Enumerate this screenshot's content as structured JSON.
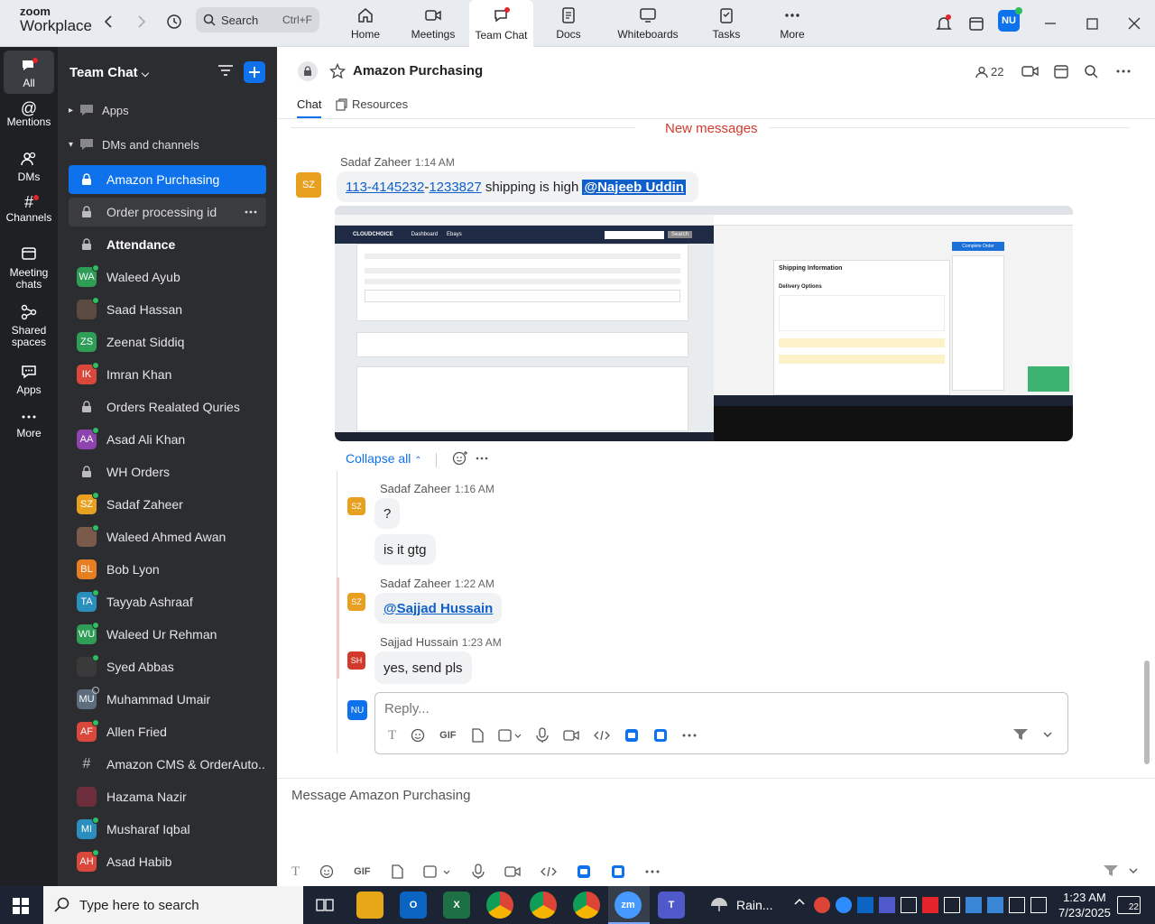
{
  "app": {
    "logo_top": "zoom",
    "logo_bottom": "Workplace"
  },
  "search": {
    "label": "Search",
    "shortcut": "Ctrl+F"
  },
  "tabs": [
    {
      "label": "Home"
    },
    {
      "label": "Meetings"
    },
    {
      "label": "Team Chat"
    },
    {
      "label": "Docs"
    },
    {
      "label": "Whiteboards"
    },
    {
      "label": "Tasks"
    },
    {
      "label": "More"
    }
  ],
  "user": {
    "initials": "NU"
  },
  "rail": [
    {
      "label": "All"
    },
    {
      "label": "Mentions"
    },
    {
      "label": "DMs"
    },
    {
      "label": "Channels"
    },
    {
      "label": "Meeting chats"
    },
    {
      "label": "Shared spaces"
    },
    {
      "label": "Apps"
    },
    {
      "label": "More"
    }
  ],
  "sidebar": {
    "title": "Team Chat",
    "sections": {
      "apps": "Apps",
      "dms": "DMs and channels"
    },
    "items": [
      {
        "label": "Amazon Purchasing",
        "kind": "lock",
        "state": "selected"
      },
      {
        "label": "Order processing id",
        "kind": "lock",
        "state": "hover"
      },
      {
        "label": "Attendance",
        "kind": "lock",
        "state": "bold"
      },
      {
        "label": "Waleed Ayub",
        "kind": "avatar",
        "initials": "WA",
        "color": "#2e9e57",
        "status": "online"
      },
      {
        "label": "Saad Hassan",
        "kind": "photo",
        "color": "#5a4a40",
        "status": "online"
      },
      {
        "label": "Zeenat Siddiq",
        "kind": "avatar",
        "initials": "ZS",
        "color": "#2e9e57",
        "status": "none"
      },
      {
        "label": "Imran Khan",
        "kind": "avatar",
        "initials": "IK",
        "color": "#d9483b",
        "status": "online"
      },
      {
        "label": "Orders Realated Quries",
        "kind": "lock"
      },
      {
        "label": "Asad Ali Khan",
        "kind": "avatar",
        "initials": "AA",
        "color": "#8e44ad",
        "status": "online"
      },
      {
        "label": "WH Orders",
        "kind": "lock"
      },
      {
        "label": "Sadaf Zaheer",
        "kind": "avatar",
        "initials": "SZ",
        "color": "#e8a020",
        "status": "online"
      },
      {
        "label": "Waleed Ahmed Awan",
        "kind": "photo",
        "color": "#7a5a4a",
        "status": "online"
      },
      {
        "label": "Bob Lyon",
        "kind": "avatar",
        "initials": "BL",
        "color": "#e67e22",
        "status": "none"
      },
      {
        "label": "Tayyab Ashraaf",
        "kind": "avatar",
        "initials": "TA",
        "color": "#2a8fbd",
        "status": "online"
      },
      {
        "label": "Waleed Ur Rehman",
        "kind": "avatar",
        "initials": "WU",
        "color": "#2e9e57",
        "status": "online"
      },
      {
        "label": "Syed Abbas",
        "kind": "photo",
        "color": "#3a3a3a",
        "status": "online"
      },
      {
        "label": "Muhammad Umair",
        "kind": "avatar",
        "initials": "MU",
        "color": "#5d6d7e",
        "status": "offline"
      },
      {
        "label": "Allen Fried",
        "kind": "avatar",
        "initials": "AF",
        "color": "#d9483b",
        "status": "online"
      },
      {
        "label": "Amazon CMS & OrderAuto...",
        "kind": "hash"
      },
      {
        "label": "Hazama Nazir",
        "kind": "photo",
        "color": "#6b2e3a",
        "status": "none"
      },
      {
        "label": "Musharaf Iqbal",
        "kind": "avatar",
        "initials": "MI",
        "color": "#2a8fbd",
        "status": "online"
      },
      {
        "label": "Asad Habib",
        "kind": "avatar",
        "initials": "AH",
        "color": "#d9483b",
        "status": "online"
      }
    ]
  },
  "channel": {
    "name": "Amazon Purchasing",
    "members": "22",
    "tab_chat": "Chat",
    "tab_resources": "Resources",
    "new_messages": "New messages"
  },
  "messages": {
    "m1": {
      "initials": "SZ",
      "sender": "Sadaf Zaheer",
      "time": "1:14 AM",
      "link1": "113-4145232",
      "dash": "-",
      "link2": "1233827",
      "text": " shipping is high ",
      "mention": "@Najeeb Uddin"
    },
    "collapse": "Collapse all",
    "r1": {
      "initials": "SZ",
      "sender": "Sadaf Zaheer",
      "time": "1:16 AM",
      "b1": "?",
      "b2": "is it gtg"
    },
    "r2": {
      "initials": "SZ",
      "sender": "Sadaf Zaheer",
      "time": "1:22 AM",
      "mention": "@Sajjad Hussain"
    },
    "r3": {
      "initials": "SH",
      "sender": "Sajjad Hussain",
      "time": "1:23 AM",
      "text": "yes, send pls"
    }
  },
  "reply": {
    "initials": "NU",
    "placeholder": "Reply..."
  },
  "composer": {
    "placeholder": "Message Amazon Purchasing"
  },
  "screenshot_left": {
    "shop": "CLOUDCHOICE",
    "nav1": "Dashboard",
    "nav2": "Ebays",
    "search_btn": "Search"
  },
  "screenshot_right": {
    "heading": "Shipping Information",
    "sub": "Delivery Options",
    "btn": "Complete Order"
  },
  "taskbar": {
    "search_placeholder": "Type here to search",
    "weather": "Rain...",
    "time": "1:23 AM",
    "date": "7/23/2025",
    "notif_count": "22"
  },
  "colors": {
    "accent": "#0e72ed",
    "rail_bg": "#1e2024",
    "sidebar_bg": "#2b2d31",
    "new_messages": "#d23b2b"
  }
}
